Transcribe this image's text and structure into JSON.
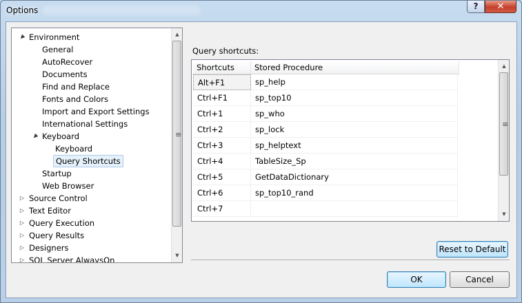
{
  "window": {
    "title": "Options",
    "help_glyph": "?",
    "close_glyph": "✕"
  },
  "tree": {
    "items": [
      {
        "label": "Environment",
        "expander": "▲"
      },
      {
        "label": "General",
        "expander": ""
      },
      {
        "label": "AutoRecover",
        "expander": ""
      },
      {
        "label": "Documents",
        "expander": ""
      },
      {
        "label": "Find and Replace",
        "expander": ""
      },
      {
        "label": "Fonts and Colors",
        "expander": ""
      },
      {
        "label": "Import and Export Settings",
        "expander": ""
      },
      {
        "label": "International Settings",
        "expander": ""
      },
      {
        "label": "Keyboard",
        "expander": "▲"
      },
      {
        "label": "Keyboard",
        "expander": ""
      },
      {
        "label": "Query Shortcuts",
        "expander": ""
      },
      {
        "label": "Startup",
        "expander": ""
      },
      {
        "label": "Web Browser",
        "expander": ""
      },
      {
        "label": "Source Control",
        "expander": "▷"
      },
      {
        "label": "Text Editor",
        "expander": "▷"
      },
      {
        "label": "Query Execution",
        "expander": "▷"
      },
      {
        "label": "Query Results",
        "expander": "▷"
      },
      {
        "label": "Designers",
        "expander": "▷"
      },
      {
        "label": "SQL Server AlwaysOn",
        "expander": "▷"
      }
    ]
  },
  "query_shortcuts": {
    "group_label": "Query shortcuts:",
    "columns": [
      "Shortcuts",
      "Stored Procedure"
    ],
    "rows": [
      [
        "Alt+F1",
        "sp_help"
      ],
      [
        "Ctrl+F1",
        "sp_top10"
      ],
      [
        "Ctrl+1",
        "sp_who"
      ],
      [
        "Ctrl+2",
        "sp_lock"
      ],
      [
        "Ctrl+3",
        "sp_helptext"
      ],
      [
        "Ctrl+4",
        "TableSize_Sp"
      ],
      [
        "Ctrl+5",
        "GetDataDictionary"
      ],
      [
        "Ctrl+6",
        "sp_top10_rand"
      ],
      [
        "Ctrl+7",
        ""
      ]
    ]
  },
  "buttons": {
    "reset": "Reset to Default",
    "ok": "OK",
    "cancel": "Cancel"
  },
  "scroll_glyphs": {
    "up": "▲",
    "down": "▼",
    "grip": "≡"
  }
}
